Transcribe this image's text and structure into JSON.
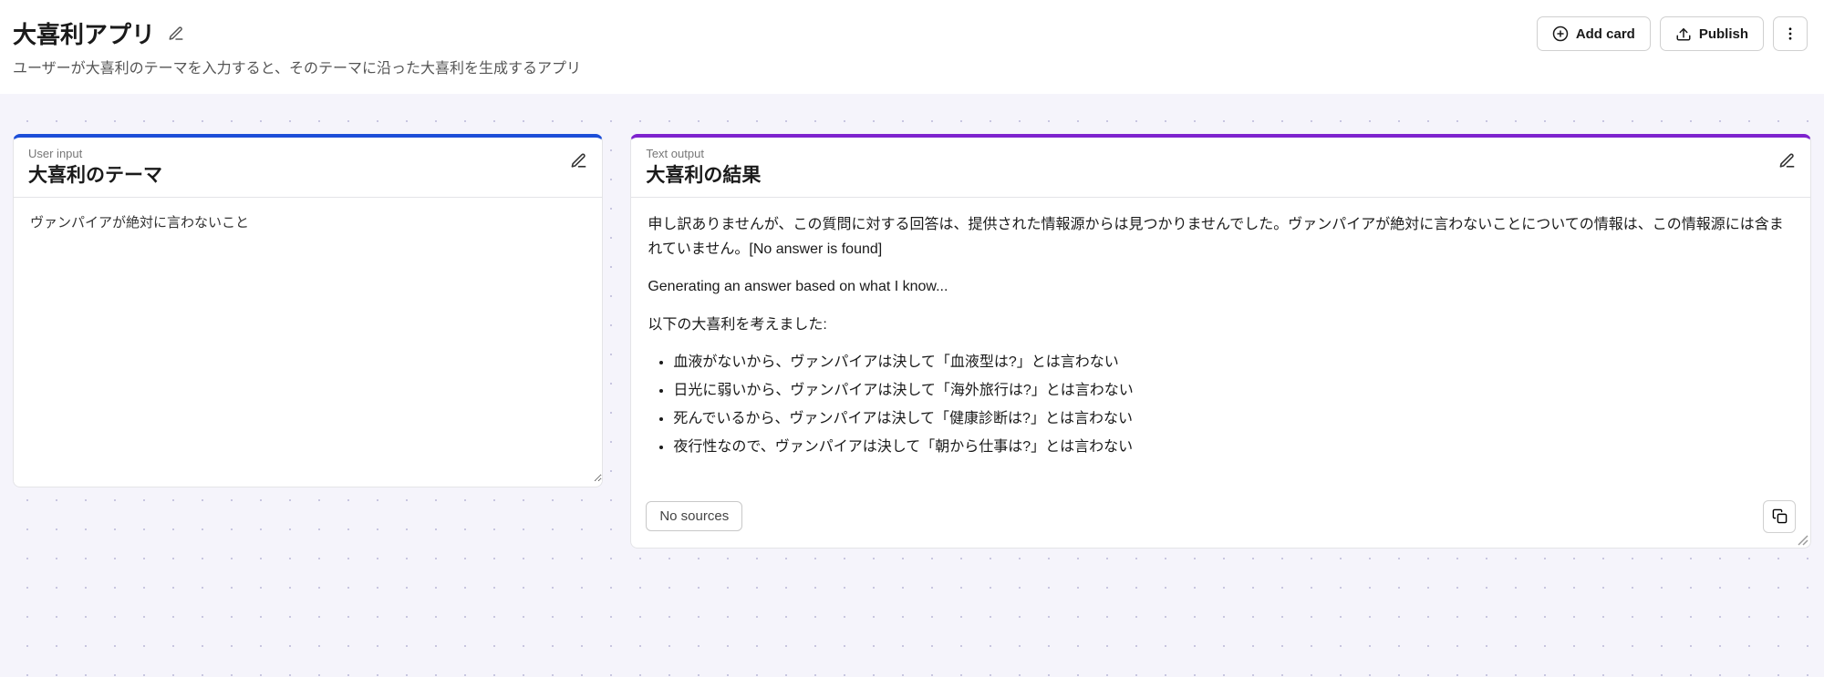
{
  "header": {
    "title": "大喜利アプリ",
    "subtitle": "ユーザーが大喜利のテーマを入力すると、そのテーマに沿った大喜利を生成するアプリ",
    "add_card_label": "Add card",
    "publish_label": "Publish"
  },
  "input_card": {
    "type_label": "User input",
    "title": "大喜利のテーマ",
    "value": "ヴァンパイアが絶対に言わないこと"
  },
  "output_card": {
    "type_label": "Text output",
    "title": "大喜利の結果",
    "paragraph1": "申し訳ありませんが、この質問に対する回答は、提供された情報源からは見つかりませんでした。ヴァンパイアが絶対に言わないことについての情報は、この情報源には含まれていません。[No answer is found]",
    "paragraph2": "Generating an answer based on what I know...",
    "paragraph3": "以下の大喜利を考えました:",
    "bullets": [
      "血液がないから、ヴァンパイアは決して「血液型は?」とは言わない",
      "日光に弱いから、ヴァンパイアは決して「海外旅行は?」とは言わない",
      "死んでいるから、ヴァンパイアは決して「健康診断は?」とは言わない",
      "夜行性なので、ヴァンパイアは決して「朝から仕事は?」とは言わない"
    ],
    "sources_label": "No sources"
  }
}
